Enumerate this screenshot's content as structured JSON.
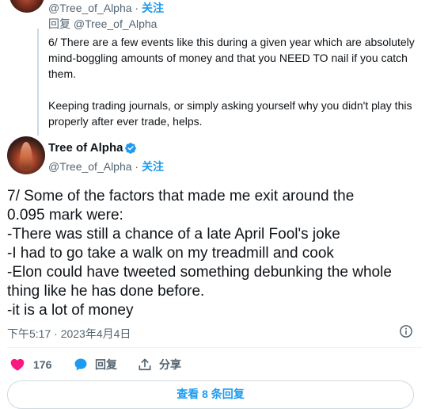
{
  "parent_tweet": {
    "handle": "@Tree_of_Alpha",
    "separator": " · ",
    "follow_label": "关注",
    "reply_prefix": "回复 ",
    "reply_mention": "@Tree_of_Alpha",
    "paragraphs": [
      "6/ There are a few events like this during a given year which are absolutely mind-boggling amounts of money and that you NEED TO nail if you catch them.",
      "Keeping trading journals, or simply asking yourself why you didn't play this properly after ever trade, helps."
    ]
  },
  "main_tweet": {
    "display_name": "Tree of Alpha",
    "handle": "@Tree_of_Alpha",
    "separator": " · ",
    "follow_label": "关注",
    "lines": [
      "7/ Some of the factors that made me exit around the",
      "0.095 mark were:",
      "-There was still a chance of a late April Fool's joke",
      "-I had to go take a walk on my treadmill and cook",
      "-Elon could have tweeted something debunking the whole",
      "thing like he has done before.",
      "-it is a lot of money"
    ],
    "timestamp": "下午5:17 · 2023年4月4日"
  },
  "actions": {
    "like_count": "176",
    "reply_label": "回复",
    "share_label": "分享"
  },
  "more_replies_label": "查看 8 条回复",
  "colors": {
    "accent": "#1d9bf0",
    "like": "#f91880",
    "muted": "#536471",
    "text": "#0f1419"
  }
}
